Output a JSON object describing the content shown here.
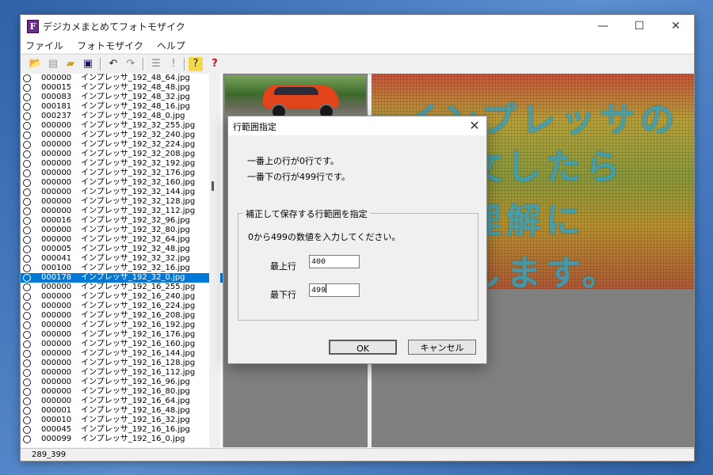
{
  "window": {
    "title": "デジカメまとめてフォトモザイク",
    "icon_letter": "F",
    "minimize": "—",
    "maximize": "☐",
    "close": "✕"
  },
  "menu": [
    "ファイル",
    "フォトモザイク",
    "ヘルプ"
  ],
  "file_list": [
    {
      "num": "000000",
      "name": "インプレッサ_192_48_64.jpg"
    },
    {
      "num": "000015",
      "name": "インプレッサ_192_48_48.jpg"
    },
    {
      "num": "000083",
      "name": "インプレッサ_192_48_32.jpg"
    },
    {
      "num": "000181",
      "name": "インプレッサ_192_48_16.jpg"
    },
    {
      "num": "000237",
      "name": "インプレッサ_192_48_0.jpg"
    },
    {
      "num": "000000",
      "name": "インプレッサ_192_32_255.jpg"
    },
    {
      "num": "000000",
      "name": "インプレッサ_192_32_240.jpg"
    },
    {
      "num": "000000",
      "name": "インプレッサ_192_32_224.jpg"
    },
    {
      "num": "000000",
      "name": "インプレッサ_192_32_208.jpg"
    },
    {
      "num": "000000",
      "name": "インプレッサ_192_32_192.jpg"
    },
    {
      "num": "000000",
      "name": "インプレッサ_192_32_176.jpg"
    },
    {
      "num": "000000",
      "name": "インプレッサ_192_32_160.jpg"
    },
    {
      "num": "000000",
      "name": "インプレッサ_192_32_144.jpg"
    },
    {
      "num": "000000",
      "name": "インプレッサ_192_32_128.jpg"
    },
    {
      "num": "000000",
      "name": "インプレッサ_192_32_112.jpg"
    },
    {
      "num": "000016",
      "name": "インプレッサ_192_32_96.jpg"
    },
    {
      "num": "000000",
      "name": "インプレッサ_192_32_80.jpg"
    },
    {
      "num": "000000",
      "name": "インプレッサ_192_32_64.jpg"
    },
    {
      "num": "000005",
      "name": "インプレッサ_192_32_48.jpg"
    },
    {
      "num": "000041",
      "name": "インプレッサ_192_32_32.jpg"
    },
    {
      "num": "000100",
      "name": "インプレッサ_192_32_16.jpg"
    },
    {
      "num": "000178",
      "name": "インプレッサ_192_32_0.jpg",
      "selected": true
    },
    {
      "num": "000000",
      "name": "インプレッサ_192_16_255.jpg"
    },
    {
      "num": "000000",
      "name": "インプレッサ_192_16_240.jpg"
    },
    {
      "num": "000000",
      "name": "インプレッサ_192_16_224.jpg"
    },
    {
      "num": "000000",
      "name": "インプレッサ_192_16_208.jpg"
    },
    {
      "num": "000000",
      "name": "インプレッサ_192_16_192.jpg"
    },
    {
      "num": "000000",
      "name": "インプレッサ_192_16_176.jpg"
    },
    {
      "num": "000000",
      "name": "インプレッサ_192_16_160.jpg"
    },
    {
      "num": "000000",
      "name": "インプレッサ_192_16_144.jpg"
    },
    {
      "num": "000000",
      "name": "インプレッサ_192_16_128.jpg"
    },
    {
      "num": "000000",
      "name": "インプレッサ_192_16_112.jpg"
    },
    {
      "num": "000000",
      "name": "インプレッサ_192_16_96.jpg"
    },
    {
      "num": "000000",
      "name": "インプレッサ_192_16_80.jpg"
    },
    {
      "num": "000000",
      "name": "インプレッサ_192_16_64.jpg"
    },
    {
      "num": "000001",
      "name": "インプレッサ_192_16_48.jpg"
    },
    {
      "num": "000010",
      "name": "インプレッサ_192_16_32.jpg"
    },
    {
      "num": "000045",
      "name": "インプレッサ_192_16_16.jpg"
    },
    {
      "num": "000099",
      "name": "インプレッサ_192_16_0.jpg"
    }
  ],
  "mosaic_lines": [
    "インプレッサの",
    "ご注文したら",
    "全席理解に",
    "いたします。"
  ],
  "status": "289_399",
  "dialog": {
    "title": "行範囲指定",
    "close": "✕",
    "line_top": "一番上の行が0行です。",
    "line_bottom": "一番下の行が499行です。",
    "group_title": "補正して保存する行範囲を指定",
    "group_desc": "0から499の数値を入力してください。",
    "top_label": "最上行",
    "top_value": "400",
    "bottom_label": "最下行",
    "bottom_value": "499",
    "ok": "OK",
    "cancel": "キャンセル"
  }
}
